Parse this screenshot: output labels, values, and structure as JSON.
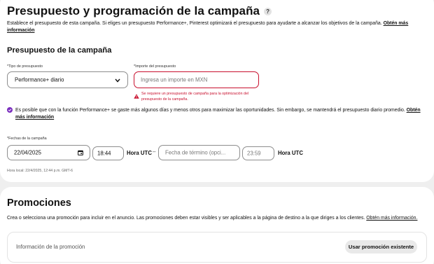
{
  "budget": {
    "title": "Presupuesto y programación de la campaña",
    "help_icon": "?",
    "description": "Establece el presupuesto de esta campaña. Si eliges un presupuesto Performance+, Pinterest optimizará el presupuesto para ayudarte a alcanzar los objetivos de la campaña.",
    "description_link": "Obtén más información",
    "section_title": "Presupuesto de la campaña",
    "type_label": "*Tipo de presupuesto",
    "type_value": "Performance+ diario",
    "amount_label": "*Importe del presupuesto",
    "amount_placeholder": "Ingresa un importe en MXN",
    "error_text": "Se requiere un presupuesto de campaña para la optimización del presupuesto de la campaña.",
    "note_text": "Es posible que con la función Performance+ se gaste más algunos días y menos otros para maximizar las oportunidades. Sin embargo, se mantendrá el presupuesto diario promedio.",
    "note_link": "Obtén más información",
    "dates_label": "*Fechas de la campaña",
    "start_date": "22/04/2025",
    "start_time": "18:44",
    "utc_label_1": "Hora UTC",
    "dash": "–",
    "end_date_placeholder": "Fecha de término (opci...",
    "end_time_placeholder": "23:59",
    "utc_label_2": "Hora UTC",
    "local_time": "Hora local: 22/4/2025, 12:44 p.m. GMT-6"
  },
  "promotions": {
    "title": "Promociones",
    "description": "Crea o selecciona una promoción para incluir en el anuncio. Las promociones deben estar visibles y ser aplicables a la página de destino a la que diriges a los clientes.",
    "description_link": "Obtén más información.",
    "info_label": "Información de la promoción",
    "use_button": "Usar promoción existente"
  },
  "colors": {
    "error": "#c8102e",
    "accent": "#7b2fbe",
    "background": "#efefef"
  },
  "icons": [
    "help-icon",
    "chevron-down-icon",
    "warning-icon",
    "check-circle-icon",
    "calendar-icon"
  ]
}
